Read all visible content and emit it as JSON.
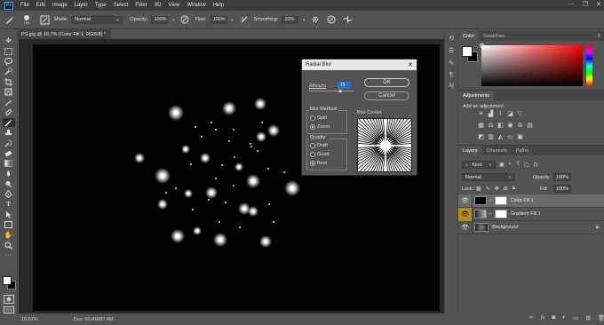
{
  "app": {
    "logo": "Ps"
  },
  "menu": [
    "File",
    "Edit",
    "Image",
    "Layer",
    "Type",
    "Select",
    "Filter",
    "3D",
    "View",
    "Window",
    "Help"
  ],
  "window_controls": {
    "minimize": "—",
    "restore": "❐",
    "close": "✕"
  },
  "options_bar": {
    "brush_size": "100",
    "mode_label": "Mode:",
    "mode_value": "Normal",
    "opacity_label": "Opacity:",
    "opacity_value": "100%",
    "flow_label": "Flow:",
    "flow_value": "100%",
    "smoothing_label": "Smoothing:",
    "smoothing_value": "10%"
  },
  "document": {
    "tab_title": "PS.jpg @ 16,7% (Color Fill 1, RGB/8) *",
    "zoom": "16,67%",
    "doc_info": "Doc: 60,4M/87,4M"
  },
  "dialog": {
    "title": "Radial Blur",
    "amount_label": "Amount",
    "amount_value": "75",
    "ok_label": "OK",
    "cancel_label": "Cancel",
    "blur_method_label": "Blur Method:",
    "method_spin": "Spin",
    "method_zoom": "Zoom",
    "quality_label": "Quality:",
    "quality_draft": "Draft",
    "quality_good": "Good",
    "quality_best": "Best",
    "blur_center_label": "Blur Center",
    "selected_method": "Zoom",
    "selected_quality": "Best"
  },
  "color_panel": {
    "tabs": [
      "Color",
      "Swatches"
    ],
    "active_tab": "Color",
    "foreground": "#ffffff",
    "hue_color": "#ff0000"
  },
  "adjustments_panel": {
    "title": "Adjustments",
    "subtitle": "Add an adjustment"
  },
  "layers_panel": {
    "tabs": [
      "Layers",
      "Channels",
      "Paths"
    ],
    "active_tab": "Layers",
    "filter_kind": "Kind",
    "blend_mode": "Normal",
    "opacity_label": "Opacity:",
    "opacity_value": "100%",
    "lock_label": "Lock:",
    "fill_label": "Fill:",
    "fill_value": "100%",
    "layers": [
      {
        "name": "Color Fill 1",
        "selected": true
      },
      {
        "name": "Gradient Fill 1",
        "selected": false
      },
      {
        "name": "Background",
        "selected": false
      }
    ]
  },
  "colors": {
    "accent": "#31a8ff",
    "highlight_eye": "#b68a1c"
  }
}
